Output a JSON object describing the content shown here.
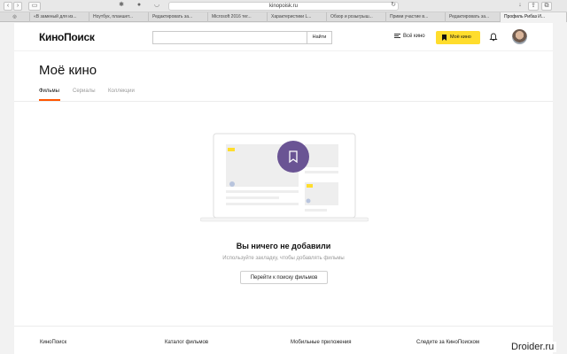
{
  "browser": {
    "url": "kinopoisk.ru",
    "tabs": [
      "«В заменый для из...",
      "Ноутбук, планшет...",
      "Редактировать за...",
      "Microsoft 2016 тег...",
      "Характеристики L...",
      "Обзор и розыгрыш...",
      "Прими участие в...",
      "Редактировать за...",
      "Профиль Рибаз И..."
    ]
  },
  "header": {
    "logo": "КиноПоиск",
    "search_placeholder": "",
    "search_button": "Найти",
    "all_movies": "Всё кино",
    "my_movies": "Моё кино"
  },
  "main": {
    "title": "Моё кино",
    "tabs": [
      "Фильмы",
      "Сериалы",
      "Коллекции"
    ],
    "empty_title": "Вы ничего не добавили",
    "empty_subtitle": "Используйте закладку, чтобы добавлять фильмы",
    "find_button": "Перейти к поиску фильмов"
  },
  "footer": {
    "items": [
      "КиноПоиск",
      "Каталог фильмов",
      "Мобильные приложения",
      "Следите за КиноПоиском"
    ]
  },
  "watermark": "Droider.ru",
  "colors": {
    "accent": "#ffdd2d",
    "tab_underline": "#ff5500",
    "bookmark_circle": "#6a5494"
  }
}
